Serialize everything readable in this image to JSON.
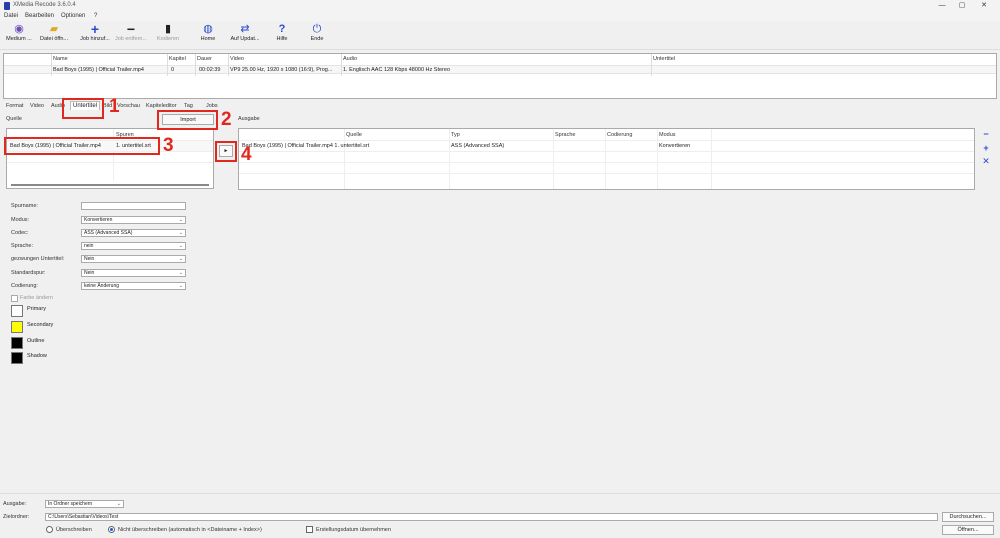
{
  "window": {
    "title": "XMedia Recode 3.6.0.4",
    "controls": [
      "—",
      "▢",
      "✕"
    ]
  },
  "menu": [
    "Datei",
    "Bearbeiten",
    "Optionen",
    "?"
  ],
  "toolbar": [
    {
      "label": "Medium ...",
      "icon": "disc-icon"
    },
    {
      "label": "Datei öffn...",
      "icon": "folder-open-icon"
    },
    {
      "label": "Job hinzuf...",
      "icon": "plus-icon"
    },
    {
      "label": "Job entfern...",
      "icon": "minus-icon"
    },
    {
      "label": "Kodieren",
      "icon": "encode-icon"
    },
    {
      "label": "Home",
      "icon": "globe-icon"
    },
    {
      "label": "Auf Updat...",
      "icon": "update-arrows-icon"
    },
    {
      "label": "Hilfe",
      "icon": "help-icon"
    },
    {
      "label": "Ende",
      "icon": "power-icon"
    }
  ],
  "file_table": {
    "headers": [
      "Name",
      "Kapitel",
      "Dauer",
      "Video",
      "Audio",
      "Untertitel"
    ],
    "row": {
      "name": "Bad Boys (1995)  |  Official Trailer.mp4",
      "chapters": "0",
      "duration": "00:02:39",
      "video": "VP9 25.00 Hz, 1920 x 1080 (16:9), Prog...",
      "audio": "1. Englisch AAC  128 Kbps 48000 Hz Stereo",
      "subtitle": ""
    }
  },
  "tabs": [
    "Format",
    "Video",
    "Audio",
    "Untertitel",
    "Bild",
    "Vorschau",
    "Kapiteleditor",
    "Tag",
    "Jobs"
  ],
  "active_tab": "Untertitel",
  "source": {
    "label": "Quelle",
    "import_label": "Import",
    "column": "Spuren",
    "row_file": "Bad Boys (1995)  |  Official Trailer.mp4",
    "row_track": "1. untertitel.srt"
  },
  "output": {
    "label": "Ausgabe",
    "headers": [
      "Quelle",
      "Typ",
      "Sprache",
      "Codierung",
      "Modus"
    ],
    "row": {
      "source": "Bad Boys (1995)  |  Official Trailer.mp4 1. untertitel.srt",
      "type": "ASS (Advanced SSA)",
      "language": "",
      "encoding": "",
      "mode": "Konvertieren"
    }
  },
  "form": {
    "fields": [
      {
        "label": "Spurname:",
        "value": ""
      },
      {
        "label": "Modus:",
        "value": "Konvertieren"
      },
      {
        "label": "Codec:",
        "value": "ASS (Advanced SSA)"
      },
      {
        "label": "Sprache:",
        "value": "nein"
      },
      {
        "label": "gezwungen Untertitel:",
        "value": "Nein"
      },
      {
        "label": "Standardspur:",
        "value": "Nein"
      },
      {
        "label": "Codierung:",
        "value": "keine Änderung"
      }
    ],
    "color_checkbox_label": "Farbe ändern",
    "colors": [
      {
        "label": "Primary",
        "color": "#ffffff"
      },
      {
        "label": "Secondary",
        "color": "#ffff00"
      },
      {
        "label": "Outline",
        "color": "#000000"
      },
      {
        "label": "Shadow",
        "color": "#000000"
      }
    ]
  },
  "bottom": {
    "output_label": "Ausgabe:",
    "output_value": "In Ordner speichern",
    "target_label": "Zielordner:",
    "target_value": "C:\\Users\\Sebastian\\Videos\\Test",
    "browse_label": "Durchsuchen...",
    "open_label": "Öffnen...",
    "radio_overwrite": "Überschreiben",
    "radio_no_overwrite": "Nicht überschreiben (automatisch in <Dateiname + Index>)",
    "checkbox_date": "Erstellungsdatum übernehmen"
  },
  "annotations": [
    "1",
    "2",
    "3",
    "4"
  ],
  "colors": {
    "annotation": "#e0281e",
    "accent": "#2c4bd1"
  }
}
